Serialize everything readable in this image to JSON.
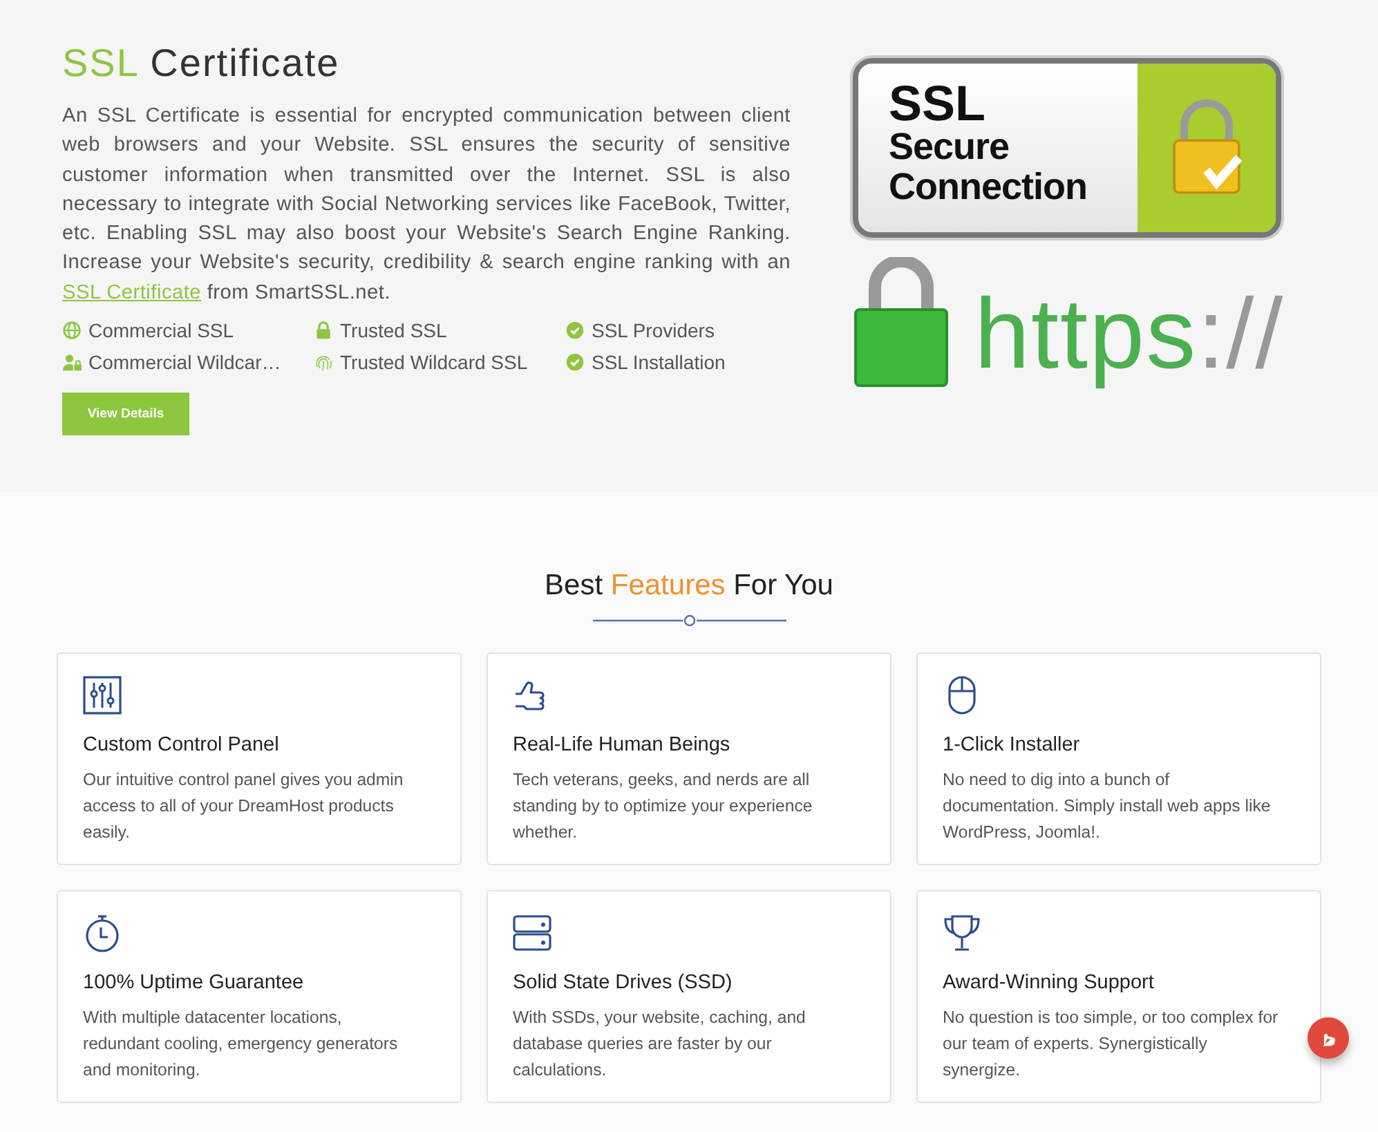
{
  "ssl_section": {
    "title": {
      "highlight": "SSL",
      "rest": "Certificate"
    },
    "intro": {
      "before": "An SSL Certificate is essential for encrypted communication between client web browsers and your Website. SSL ensures the security of sensitive customer information when transmitted over the Internet. SSL is also necessary to integrate with Social Networking services like FaceBook, Twitter, etc. Enabling SSL may also boost your Website's Search Engine Ranking. Increase your Website's security, credibility & search engine ranking with an",
      "link": "SSL Certificate",
      "after": "from SmartSSL.net."
    },
    "products": [
      {
        "label": "Commercial SSL",
        "kind": "globe"
      },
      {
        "label": "Trusted SSL",
        "kind": "lock"
      },
      {
        "label": "SSL Providers",
        "kind": "check"
      },
      {
        "label": "Commercial Wildcar…",
        "kind": "user-lock"
      },
      {
        "label": "Trusted Wildcard SSL",
        "kind": "fingerprint"
      },
      {
        "label": "SSL Installation",
        "kind": "check"
      }
    ],
    "button": "View Details",
    "badge": {
      "title": "SSL",
      "lines": [
        "Secure",
        "Connection"
      ],
      "https": "https",
      "slashes": "://"
    }
  },
  "features": {
    "heading": {
      "before": "Best",
      "highlight": "Features",
      "after": "For You"
    },
    "cards": [
      {
        "kind": "sliders",
        "title": "Custom Control Panel",
        "text": "Our intuitive control panel gives you admin access to all of your DreamHost products easily."
      },
      {
        "kind": "thumbs-up",
        "title": "Real-Life Human Beings",
        "text": "Tech veterans, geeks, and nerds are all standing by to optimize your experience whether."
      },
      {
        "kind": "mouse",
        "title": "1-Click Installer",
        "text": "No need to dig into a bunch of documentation. Simply install web apps like WordPress, Joomla!."
      },
      {
        "kind": "stopwatch",
        "title": "100% Uptime Guarantee",
        "text": "With multiple datacenter locations, redundant cooling, emergency generators and monitoring."
      },
      {
        "kind": "server",
        "title": "Solid State Drives (SSD)",
        "text": "With SSDs, your website, caching, and database queries are faster by our calculations."
      },
      {
        "kind": "trophy",
        "title": "Award-Winning Support",
        "text": "No question is too simple, or too complex for our team of experts. Synergistically synergize."
      }
    ]
  }
}
